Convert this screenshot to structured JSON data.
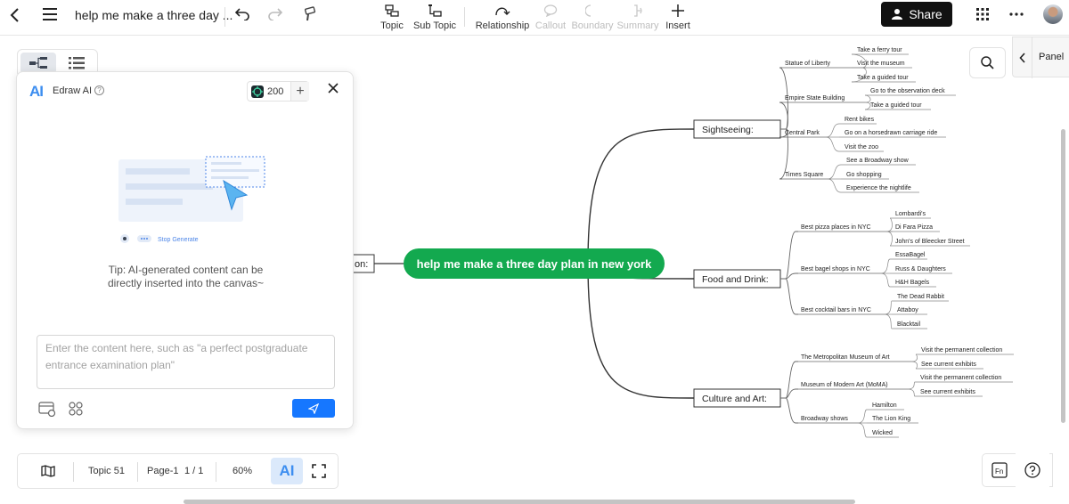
{
  "topbar": {
    "doc_title": "help me make a three day ...",
    "tools": [
      {
        "label": "Topic",
        "icon": "topic-icon",
        "enabled": true
      },
      {
        "label": "Sub Topic",
        "icon": "subtopic-icon",
        "enabled": true
      },
      {
        "label": "Relationship",
        "icon": "relationship-icon",
        "enabled": true
      },
      {
        "label": "Callout",
        "icon": "callout-icon",
        "enabled": false
      },
      {
        "label": "Boundary",
        "icon": "boundary-icon",
        "enabled": false
      },
      {
        "label": "Summary",
        "icon": "summary-icon",
        "enabled": false
      },
      {
        "label": "Insert",
        "icon": "plus-icon",
        "enabled": true
      }
    ],
    "share_label": "Share"
  },
  "ai_panel": {
    "logo": "AI",
    "title": "Edraw AI",
    "credits": "200",
    "illustration_label": "Stop Generate",
    "tip": "Tip: AI-generated content can be\ndirectly inserted into the canvas~",
    "input_placeholder": "Enter the content here, such as \"a perfect postgraduate entrance examination plan\""
  },
  "bottom_bar": {
    "topic_count": "Topic 51",
    "page": "Page-1",
    "page_of": "1 / 1",
    "zoom": "60%",
    "ai_label": "AI"
  },
  "right": {
    "panel_label": "Panel",
    "fn_label": "Fn"
  },
  "mindmap": {
    "central": "help me make a three day plan in new york",
    "left_partial": "on:",
    "branches": [
      {
        "label": "Sightseeing:",
        "topics": [
          {
            "label": "Statue of Liberty",
            "subs": [
              "Take a ferry tour",
              "Visit the museum",
              "Take a guided tour"
            ]
          },
          {
            "label": "Empire State Building",
            "subs": [
              "Go to the observation deck",
              "Take a guided tour"
            ]
          },
          {
            "label": "Central Park",
            "subs": [
              "Rent bikes",
              "Go on a horsedrawn carriage ride",
              "Visit the zoo"
            ]
          },
          {
            "label": "Times Square",
            "subs": [
              "See a Broadway show",
              "Go shopping",
              "Experience the nightlife"
            ]
          }
        ]
      },
      {
        "label": "Food and Drink:",
        "topics": [
          {
            "label": "Best pizza places in NYC",
            "subs": [
              "Lombardi's",
              "Di Fara Pizza",
              "John's of Bleecker Street"
            ]
          },
          {
            "label": "Best bagel shops in NYC",
            "subs": [
              "EssaBagel",
              "Russ & Daughters",
              "H&H Bagels"
            ]
          },
          {
            "label": "Best cocktail bars in NYC",
            "subs": [
              "The Dead Rabbit",
              "Attaboy",
              "Blacktail"
            ]
          }
        ]
      },
      {
        "label": "Culture and Art:",
        "topics": [
          {
            "label": "The Metropolitan Museum of Art",
            "subs": [
              "Visit the permanent collection",
              "See current exhibits"
            ]
          },
          {
            "label": "Museum of Modern Art (MoMA)",
            "subs": [
              "Visit the permanent collection",
              "See current exhibits"
            ]
          },
          {
            "label": "Broadway shows",
            "subs": [
              "Hamilton",
              "The Lion King",
              "Wicked"
            ]
          }
        ]
      }
    ]
  },
  "colors": {
    "central": "#13a94f",
    "accent": "#1677ff",
    "share": "#111111"
  }
}
